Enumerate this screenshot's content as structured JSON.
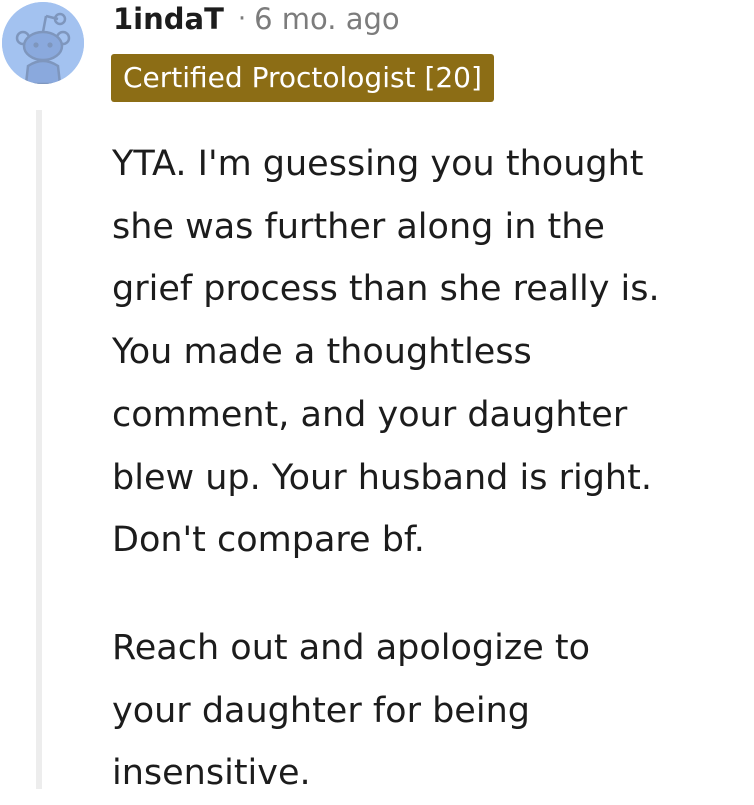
{
  "comment": {
    "username": "1indaT",
    "separator": "·",
    "timestamp": "6 mo. ago",
    "flair": "Certified Proctologist [20]",
    "avatar_icon": "snoo-avatar-icon",
    "paragraphs": [
      [
        "YTA. I'm guessing you thought",
        "she was further along in the",
        "grief process than she really is.",
        "You made a thoughtless",
        "comment, and your daughter",
        "blew up. Your husband is right.",
        "Don't compare bf."
      ],
      [
        "Reach out and apologize to",
        "your daughter for being",
        "insensitive."
      ]
    ]
  },
  "colors": {
    "flair_background": "#8c6d15",
    "avatar_background": "#a3c2f0",
    "meta_text": "#7c7c7c",
    "thread_line": "#ededed"
  }
}
